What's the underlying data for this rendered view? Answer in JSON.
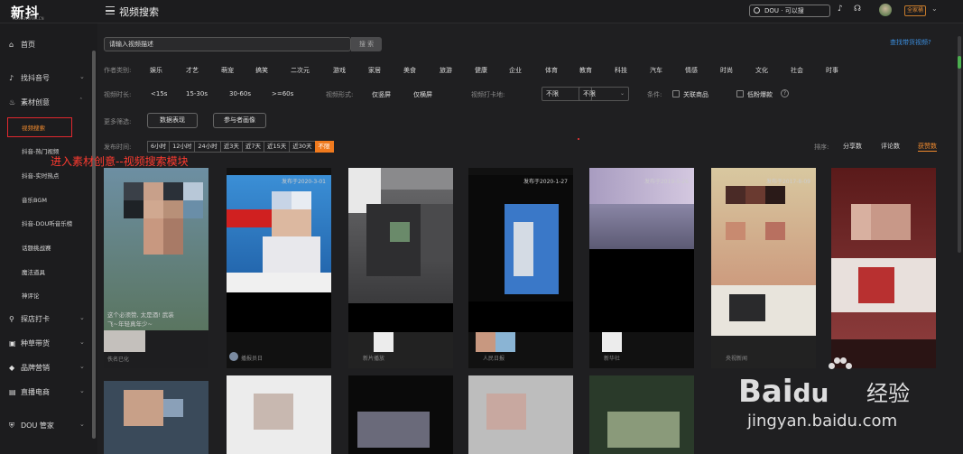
{
  "header": {
    "logo": "新抖",
    "logo_sub": "XD.NEWRANK.CN",
    "page_title": "视频搜索",
    "search_label": "DOU · 可以搜",
    "vip_label": "全家桶"
  },
  "sidebar": {
    "items": [
      {
        "label": "首页",
        "icon": "home-icon"
      },
      {
        "label": "找抖音号",
        "icon": "tiktok-icon"
      },
      {
        "label": "素材创意",
        "icon": "fire-icon"
      },
      {
        "label": "探店打卡",
        "icon": "pin-icon"
      },
      {
        "label": "种草带货",
        "icon": "bag-icon"
      },
      {
        "label": "品牌营销",
        "icon": "diamond-icon"
      },
      {
        "label": "直播电商",
        "icon": "live-icon"
      },
      {
        "label": "DOU 管家",
        "icon": "shield-icon"
      }
    ],
    "subitems": [
      "视频搜索",
      "抖音-热门视频",
      "抖音-实时热点",
      "音乐BGM",
      "抖音-DOU听音乐榜",
      "话题挑战赛",
      "魔法道具",
      "神评论"
    ]
  },
  "annotation": "进入素材创意--视频搜索模块",
  "search": {
    "placeholder": "请输入视频描述",
    "button": "搜 索",
    "find_link": "查找带货视频?"
  },
  "filters": {
    "category_label": "作者类别:",
    "categories": [
      "娱乐",
      "才艺",
      "萌宠",
      "搞笑",
      "二次元",
      "游戏",
      "家居",
      "美食",
      "旅游",
      "健康",
      "企业",
      "体育",
      "教育",
      "科技",
      "汽车",
      "情感",
      "时尚",
      "文化",
      "社会",
      "时事"
    ],
    "duration_label": "视频时长:",
    "durations": [
      "<15s",
      "15-30s",
      "30-60s",
      ">=60s"
    ],
    "form_label": "视频形式:",
    "forms": [
      "仅竖屏",
      "仅横屏"
    ],
    "checkin_label": "视频打卡地:",
    "select1": "不限",
    "select2": "不限",
    "condition_label": "条件:",
    "cond1": "关联商品",
    "cond2": "低粉爆款",
    "more_label": "更多筛选:",
    "more_btn1": "数据表现",
    "more_btn2": "参与者画像",
    "time_label": "发布时间:",
    "times": [
      "6小时",
      "12小时",
      "24小时",
      "近3天",
      "近7天",
      "近15天",
      "近30天",
      "不限"
    ],
    "time_active": "不限",
    "sort_label": "排序:",
    "sorts": [
      "分享数",
      "评论数",
      "获赞数"
    ],
    "sort_active": "获赞数"
  },
  "cards": [
    {
      "date": "",
      "caption1": "这个必须赞, 太是酒! 武装",
      "caption2": "飞~年轻真年少~",
      "author": "佚名已化"
    },
    {
      "date": "发布于2020-3-01",
      "caption1": "",
      "caption2": "",
      "author": "播报员日"
    },
    {
      "date": "",
      "caption1": "",
      "caption2": "",
      "author": "新片播放"
    },
    {
      "date": "发布于2020-1-27",
      "caption1": "",
      "caption2": "",
      "author": "人民日报"
    },
    {
      "date": "发布于2019-5-26",
      "caption1": "",
      "caption2": "",
      "author": "新华社"
    },
    {
      "date": "发布于2017-8-09",
      "caption1": "",
      "caption2": "",
      "author": "央视新闻"
    },
    {
      "date": "",
      "caption1": "",
      "caption2": "",
      "author": ""
    }
  ],
  "watermark": {
    "brand": "Bai",
    "brand2": "经验",
    "url": "jingyan.baidu.com"
  }
}
